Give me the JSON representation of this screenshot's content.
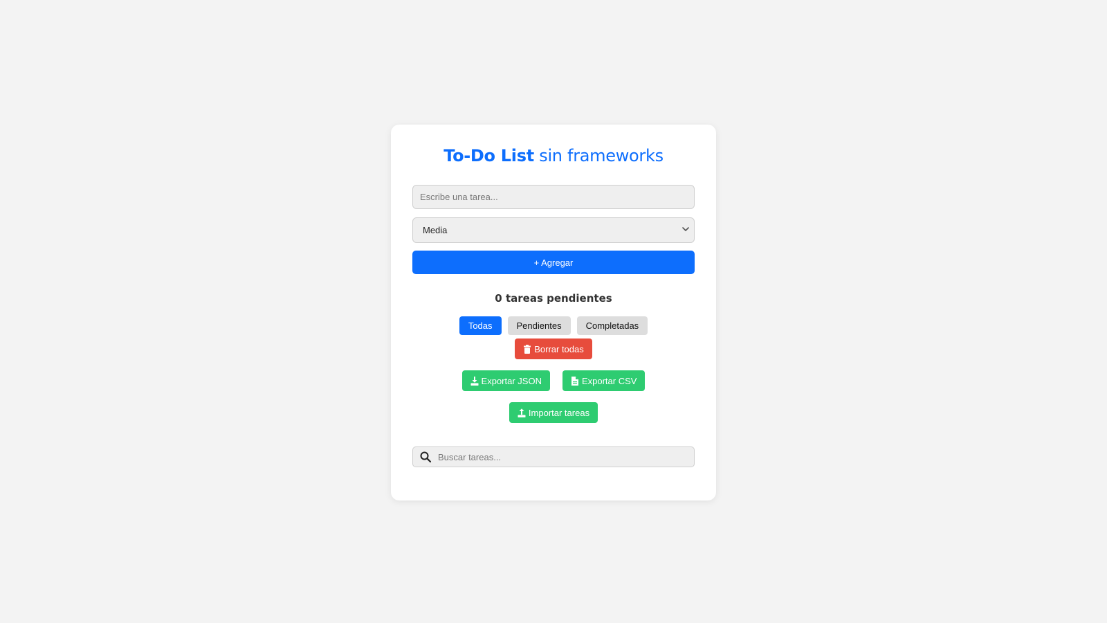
{
  "title": {
    "bold": "To-Do List",
    "rest": "sin frameworks"
  },
  "task_input": {
    "placeholder": "Escribe una tarea...",
    "value": ""
  },
  "priority": {
    "selected": "Media"
  },
  "add_button": "+ Agregar",
  "pending_text": "0 tareas pendientes",
  "filters": [
    "Todas",
    "Pendientes",
    "Completadas"
  ],
  "active_filter": "Todas",
  "actions": {
    "delete_all": "Borrar todas",
    "export_json": "Exportar JSON",
    "export_csv": "Exportar CSV",
    "import": "Importar tareas"
  },
  "search": {
    "placeholder": "Buscar tareas..."
  },
  "colors": {
    "primary": "#0d6efd",
    "danger": "#e74c3c",
    "success": "#2ecc71",
    "background": "#f3f3f3"
  },
  "icons": {
    "delete_all": "trash-icon",
    "export_json": "download-icon",
    "export_csv": "csv-file-icon",
    "import": "upload-icon",
    "search": "search-icon",
    "select": "chevron-down-icon"
  }
}
